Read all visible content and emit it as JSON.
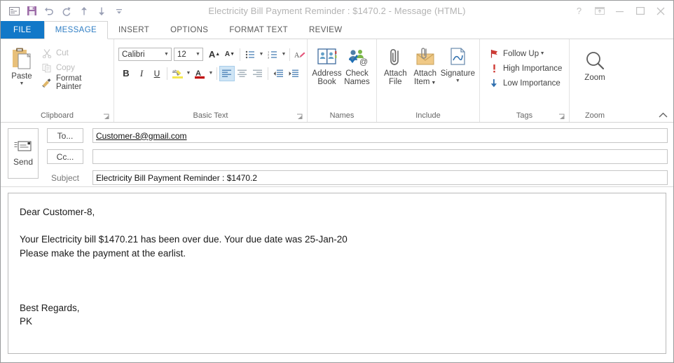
{
  "window": {
    "title": "Electricity Bill Payment Reminder : $1470.2 - Message (HTML)",
    "accent_blue": "#1278c8",
    "active_tab_color": "#2f7ec4"
  },
  "quick_access": [
    {
      "name": "envelope-icon",
      "label": "Message"
    },
    {
      "name": "save-icon",
      "label": "Save"
    },
    {
      "name": "undo-icon",
      "label": "Undo"
    },
    {
      "name": "redo-icon",
      "label": "Redo"
    },
    {
      "name": "previous-item-icon",
      "label": "Previous Item"
    },
    {
      "name": "next-item-icon",
      "label": "Next Item"
    },
    {
      "name": "customize-qat-icon",
      "label": "Customize Quick Access Toolbar"
    }
  ],
  "window_controls": [
    {
      "name": "help-button",
      "glyph": "?"
    },
    {
      "name": "ribbon-display-options-button",
      "glyph": "ribbon"
    },
    {
      "name": "minimize-button",
      "glyph": "minimize"
    },
    {
      "name": "maximize-button",
      "glyph": "maximize"
    },
    {
      "name": "close-button",
      "glyph": "close"
    }
  ],
  "tabs": [
    {
      "label": "FILE",
      "type": "file"
    },
    {
      "label": "MESSAGE",
      "type": "active"
    },
    {
      "label": "INSERT",
      "type": "normal"
    },
    {
      "label": "OPTIONS",
      "type": "normal"
    },
    {
      "label": "FORMAT TEXT",
      "type": "normal"
    },
    {
      "label": "REVIEW",
      "type": "normal"
    }
  ],
  "ribbon": {
    "clipboard": {
      "group_label": "Clipboard",
      "paste_label": "Paste",
      "items": [
        {
          "label": "Cut",
          "icon": "scissors-icon",
          "disabled": true
        },
        {
          "label": "Copy",
          "icon": "copy-icon",
          "disabled": true
        },
        {
          "label": "Format Painter",
          "icon": "format-painter-icon",
          "disabled": false
        }
      ]
    },
    "basic_text": {
      "group_label": "Basic Text",
      "font_name": "Calibri",
      "font_size": "12",
      "grow_font": "A",
      "shrink_font": "A",
      "bullets": "bullet-list-icon",
      "numbering": "numbered-list-icon",
      "clear_formatting": "clear-formatting-icon",
      "bold": "B",
      "italic": "I",
      "underline": "U",
      "highlight": "text-highlight-icon",
      "font_color": "A",
      "align_left": "align-left-icon",
      "align_center": "align-center-icon",
      "align_right": "align-right-icon",
      "decrease_indent": "decrease-indent-icon",
      "increase_indent": "increase-indent-icon",
      "active_alignment": "align_left"
    },
    "names": {
      "group_label": "Names",
      "items": [
        {
          "label_line1": "Address",
          "label_line2": "Book",
          "icon": "address-book-icon"
        },
        {
          "label_line1": "Check",
          "label_line2": "Names",
          "icon": "check-names-icon"
        }
      ]
    },
    "include": {
      "group_label": "Include",
      "items": [
        {
          "label_line1": "Attach",
          "label_line2": "File",
          "icon": "paperclip-icon",
          "caret": false
        },
        {
          "label_line1": "Attach",
          "label_line2": "Item",
          "icon": "attach-item-icon",
          "caret": true
        },
        {
          "label_line1": "Signature",
          "label_line2": "",
          "icon": "signature-icon",
          "caret": true
        }
      ]
    },
    "tags": {
      "group_label": "Tags",
      "items": [
        {
          "label": "Follow Up",
          "icon": "flag-icon",
          "caret": true
        },
        {
          "label": "High Importance",
          "icon": "exclamation-icon",
          "caret": false
        },
        {
          "label": "Low Importance",
          "icon": "down-arrow-icon",
          "caret": false
        }
      ]
    },
    "zoom": {
      "group_label": "Zoom",
      "button_label": "Zoom",
      "icon": "magnifier-icon"
    }
  },
  "compose": {
    "send_label": "Send",
    "to_button": "To...",
    "cc_button": "Cc...",
    "subject_label": "Subject",
    "to_value": "Customer-8@gmail.com",
    "cc_value": "",
    "subject_value": "Electricity Bill Payment Reminder : $1470.2"
  },
  "message_body": "Dear Customer-8,\n\nYour Electricity bill $1470.21 has been over due. Your due date was 25-Jan-20\nPlease make the payment at the earlist.\n\n\n\nBest Regards,\nPK"
}
